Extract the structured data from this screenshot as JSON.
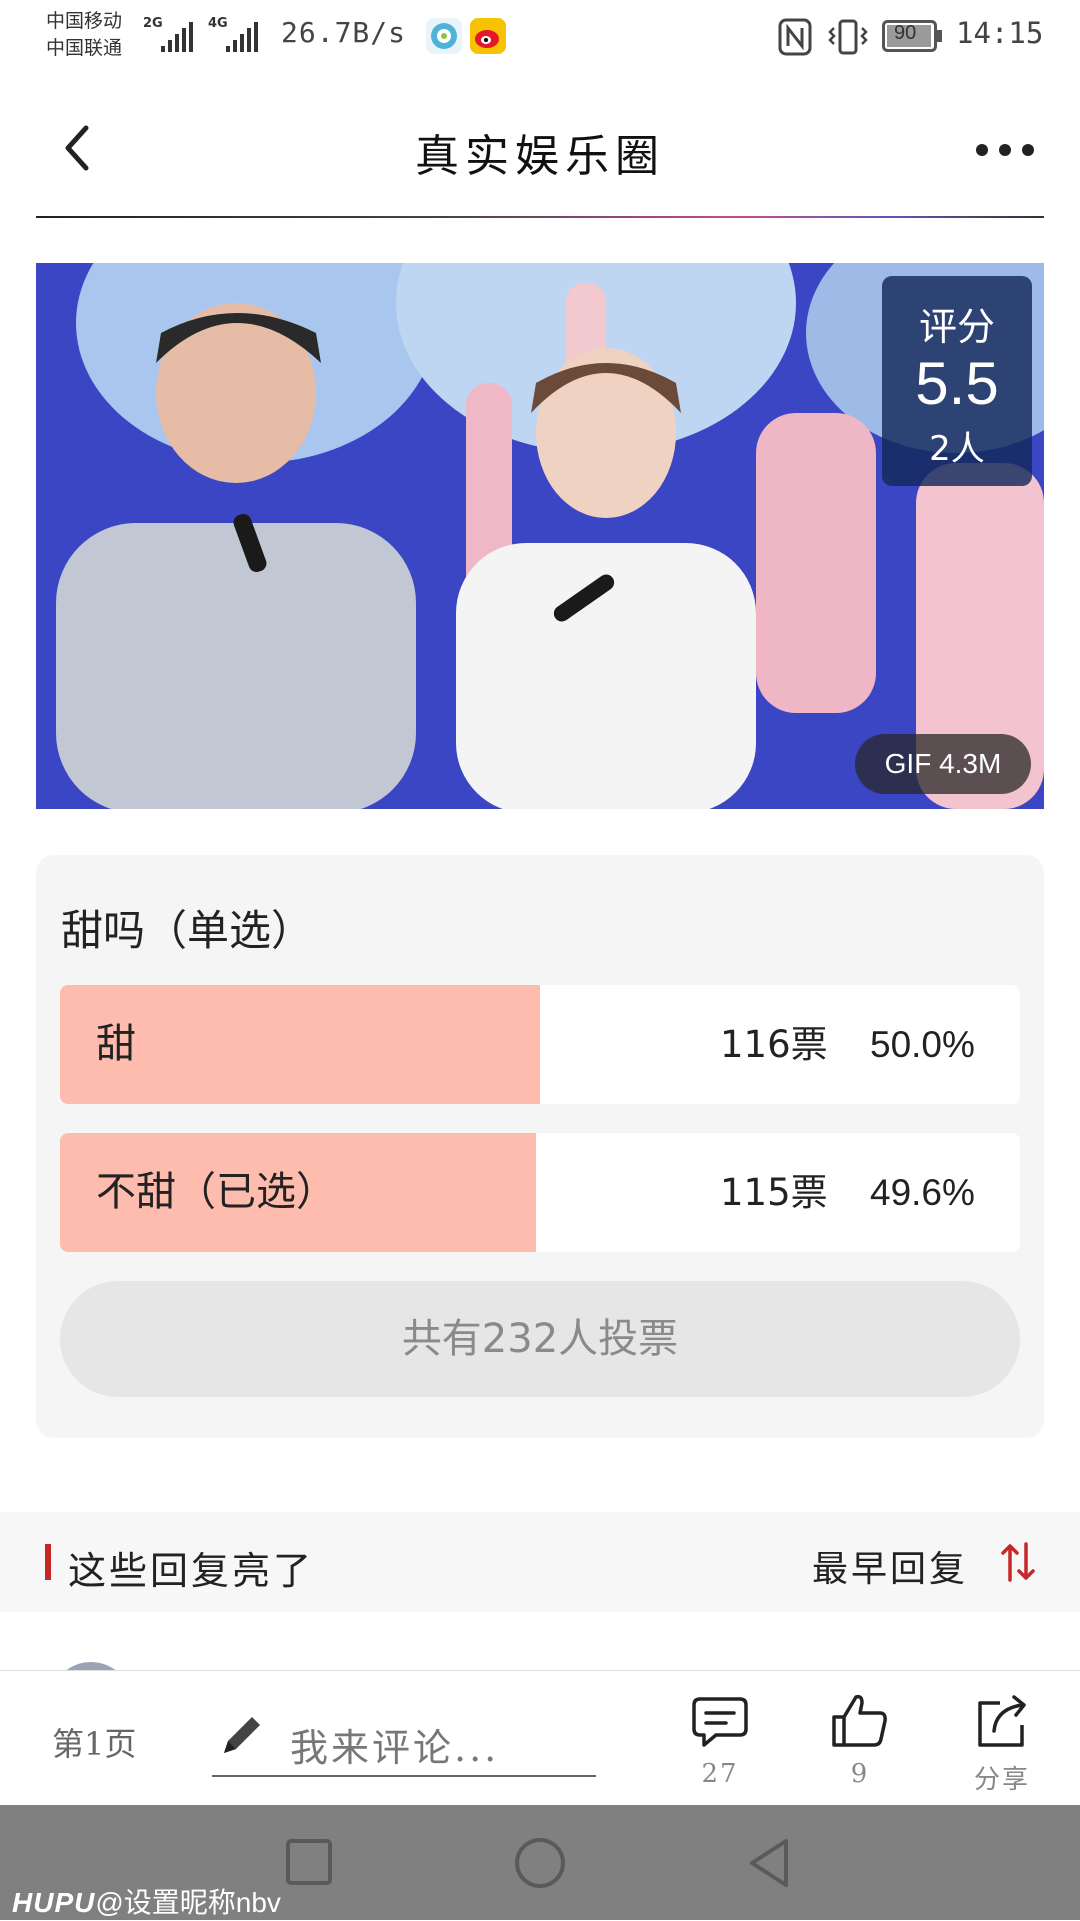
{
  "status_bar": {
    "carrier_1": "中国移动",
    "carrier_2": "中国联通",
    "net_1": "2G",
    "net_2": "4G",
    "speed": "26.7B/s",
    "battery": "90",
    "time": "14:15"
  },
  "header": {
    "title": "真实娱乐圈"
  },
  "media": {
    "score_label": "评分",
    "score_value": "5.5",
    "score_count": "2人",
    "gif_info": "GIF 4.3M"
  },
  "poll": {
    "title": "甜吗（单选）",
    "options": [
      {
        "label": "甜",
        "votes": "116票",
        "percent": "50.0%",
        "fill_fraction": 0.5
      },
      {
        "label": "不甜（已选）",
        "votes": "115票",
        "percent": "49.6%",
        "fill_fraction": 0.496
      }
    ],
    "total": "共有232人投票"
  },
  "replies": {
    "title": "这些回复亮了",
    "sort_label": "最早回复"
  },
  "bottom_bar": {
    "page": "第1页",
    "comment_placeholder": "我来评论...",
    "comment_count": "27",
    "like_count": "9",
    "share_label": "分享"
  },
  "watermark": {
    "brand": "HUPU",
    "user": "@设置昵称nbv"
  },
  "colors": {
    "poll_fill": "#fdbcad",
    "accent_red": "#c62828"
  }
}
